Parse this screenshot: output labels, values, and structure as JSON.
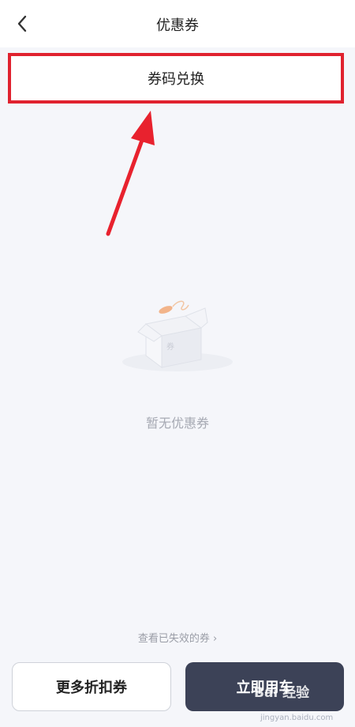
{
  "header": {
    "title": "优惠券",
    "back_icon": "chevron-left-icon"
  },
  "redeem": {
    "label": "券码兑换",
    "highlight_color": "#e0222f"
  },
  "empty_state": {
    "message": "暂无优惠券",
    "illustration": "empty-box-icon"
  },
  "expired_link": {
    "label": "查看已失效的券 ›"
  },
  "buttons": {
    "more": "更多折扣券",
    "use_car": "立即用车"
  },
  "watermark": {
    "text": "Bai 经验",
    "sub": "jingyan.baidu.com"
  }
}
